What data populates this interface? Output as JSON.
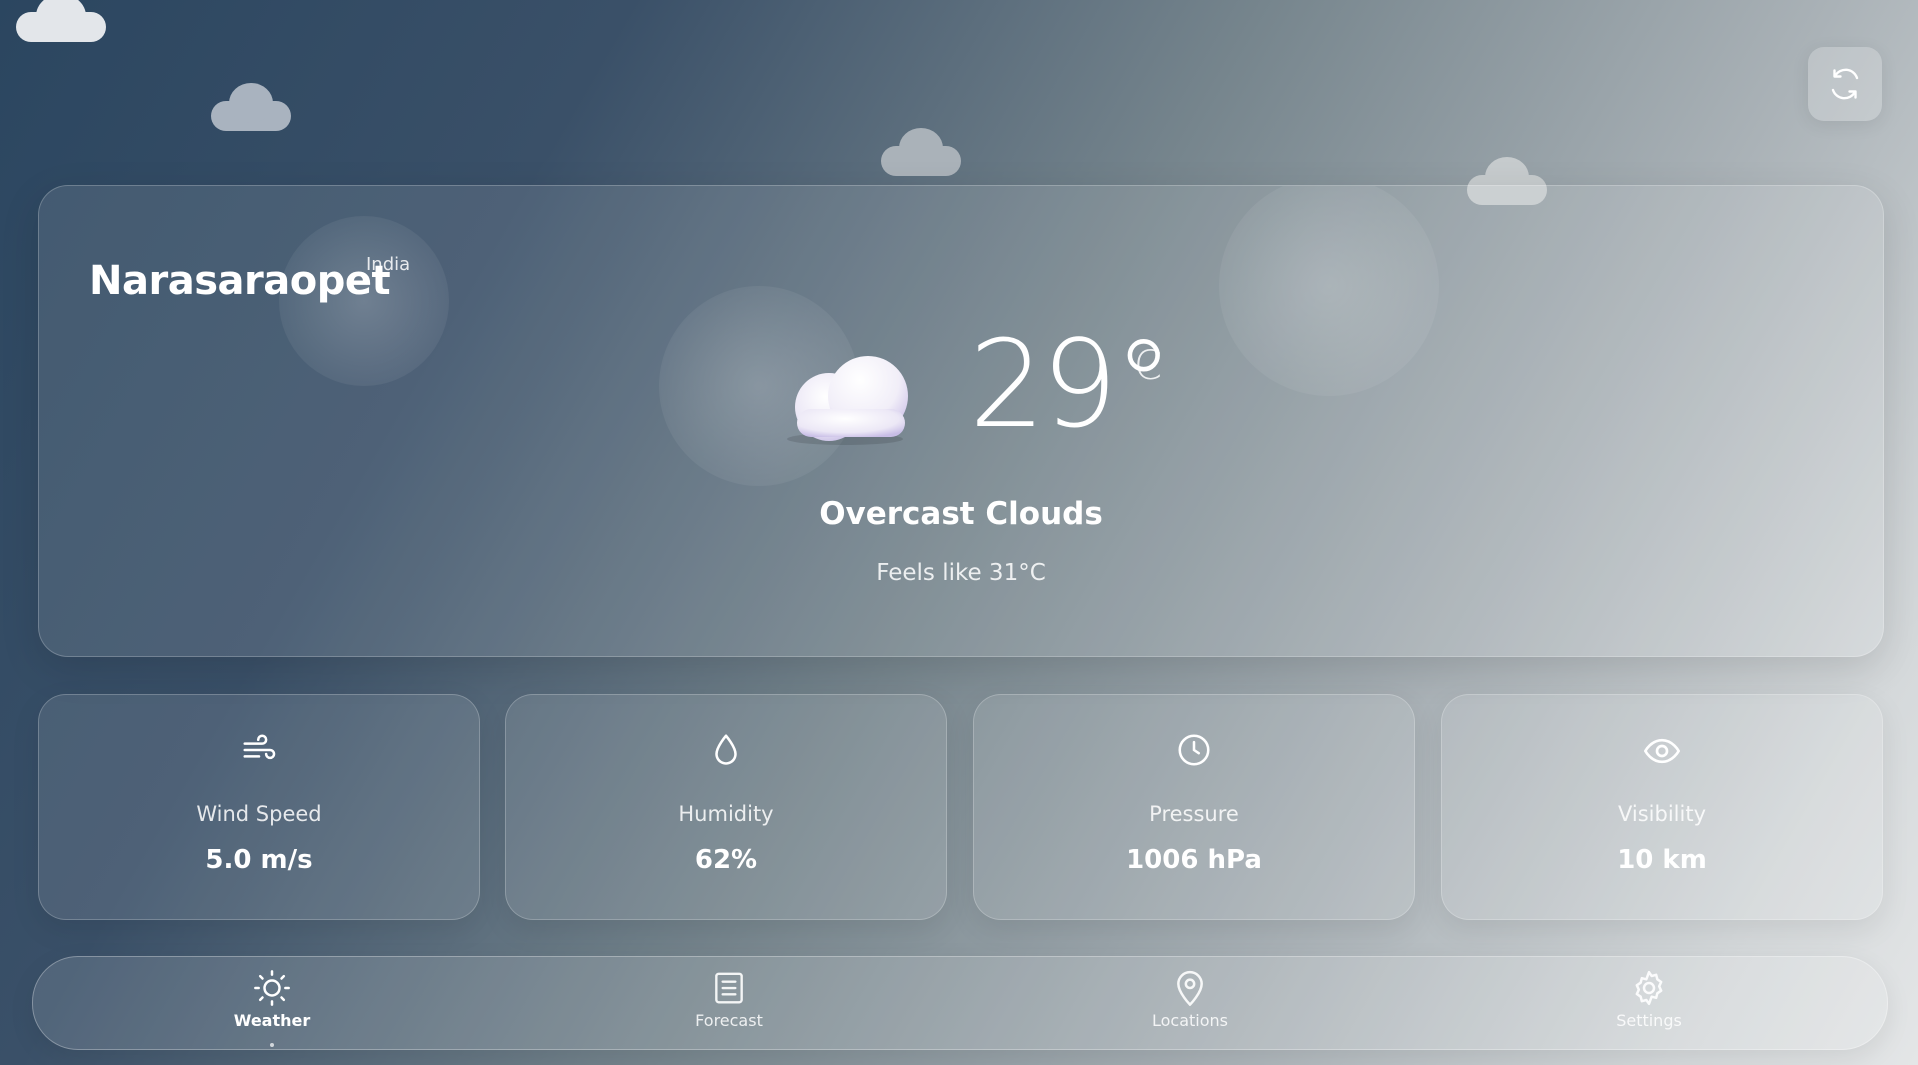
{
  "location": {
    "city": "Narasaraopet",
    "country": "India"
  },
  "current": {
    "temperature": "29°",
    "unit": "C",
    "condition": "Overcast Clouds",
    "feels_like": "Feels like 31°C",
    "icon": "cloud-icon"
  },
  "stats": [
    {
      "icon": "wind-icon",
      "label": "Wind Speed",
      "value": "5.0 m/s"
    },
    {
      "icon": "droplet-icon",
      "label": "Humidity",
      "value": "62%"
    },
    {
      "icon": "clock-icon",
      "label": "Pressure",
      "value": "1006 hPa"
    },
    {
      "icon": "eye-icon",
      "label": "Visibility",
      "value": "10 km"
    }
  ],
  "nav": {
    "active": "Weather",
    "items": [
      {
        "icon": "sun-icon",
        "label": "Weather"
      },
      {
        "icon": "document-icon",
        "label": "Forecast"
      },
      {
        "icon": "map-pin-icon",
        "label": "Locations"
      },
      {
        "icon": "gear-icon",
        "label": "Settings"
      }
    ]
  },
  "toolbar": {
    "refresh_icon": "refresh-icon"
  }
}
